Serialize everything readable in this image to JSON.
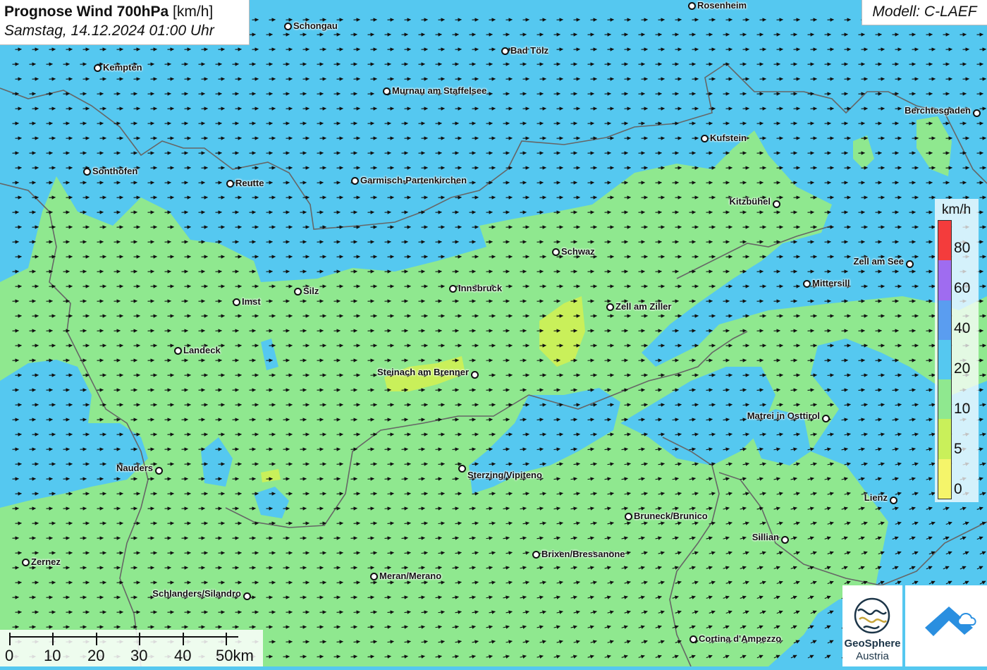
{
  "title": {
    "main": "Prognose Wind 700hPa",
    "unit": "[km/h]",
    "date": "Samstag, 14.12.2024 01:00 Uhr"
  },
  "model": "Modell: C-LAEF",
  "legend": {
    "unit": "km/h",
    "ticks": [
      "80",
      "60",
      "40",
      "20",
      "10",
      "5",
      "0"
    ],
    "colors": [
      "#f43c3c",
      "#9f6cf0",
      "#5a9df0",
      "#55c8f0",
      "#8fe88f",
      "#c9f05a",
      "#f5f56a"
    ]
  },
  "scalebar": {
    "labels": [
      "0",
      "10",
      "20",
      "30",
      "40",
      "50km"
    ]
  },
  "logos": {
    "geosphere_line1": "GeoSphere",
    "geosphere_line2": "Austria"
  },
  "wind": {
    "direction": "west-southwest"
  },
  "cities": [
    {
      "name": "Rosenheim"
    },
    {
      "name": "Schongau"
    },
    {
      "name": "Bad Tölz"
    },
    {
      "name": "Kempten"
    },
    {
      "name": "Murnau am Staffelsee"
    },
    {
      "name": "Berchtesgaden"
    },
    {
      "name": "Kufstein"
    },
    {
      "name": "Sonthofen"
    },
    {
      "name": "Reutte"
    },
    {
      "name": "Garmisch-Partenkirchen"
    },
    {
      "name": "Kitzbühel"
    },
    {
      "name": "Schwaz"
    },
    {
      "name": "Zell am See"
    },
    {
      "name": "Innsbruck"
    },
    {
      "name": "Silz"
    },
    {
      "name": "Mittersill"
    },
    {
      "name": "Imst"
    },
    {
      "name": "Zell am Ziller"
    },
    {
      "name": "Landeck"
    },
    {
      "name": "Steinach am Brenner"
    },
    {
      "name": "Matrei in Osttirol"
    },
    {
      "name": "Nauders"
    },
    {
      "name": "Sterzing/Vipiteno"
    },
    {
      "name": "Lienz"
    },
    {
      "name": "Bruneck/Brunico"
    },
    {
      "name": "Sillian"
    },
    {
      "name": "Brixen/Bressanone"
    },
    {
      "name": "Zernez"
    },
    {
      "name": "Meran/Merano"
    },
    {
      "name": "Schlanders/Silandro"
    },
    {
      "name": "Cortina d'Ampezzo"
    }
  ]
}
